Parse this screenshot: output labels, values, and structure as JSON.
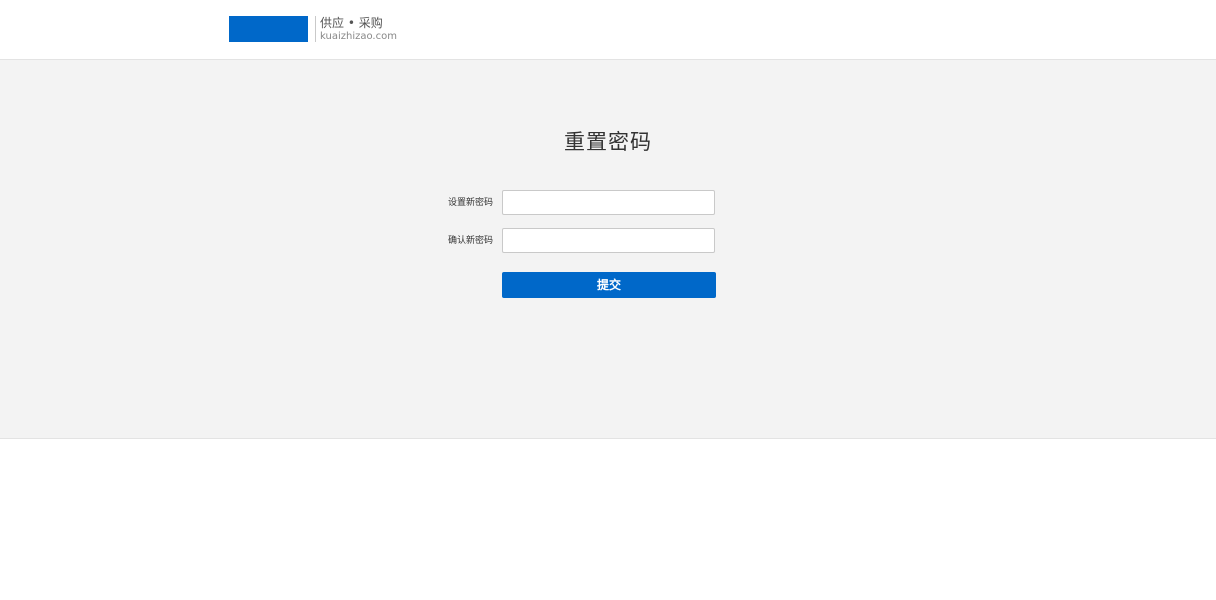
{
  "header": {
    "brand_text": "供应 • 采购",
    "brand_domain": "kuaizhizao.com"
  },
  "form": {
    "title": "重置密码",
    "new_password_label": "设置新密码",
    "new_password_value": "",
    "new_password_placeholder": "",
    "confirm_password_label": "确认新密码",
    "confirm_password_value": "",
    "confirm_password_placeholder": "",
    "submit_label": "提交"
  },
  "colors": {
    "brand": "#0068c9",
    "page_background": "#f3f3f3"
  }
}
